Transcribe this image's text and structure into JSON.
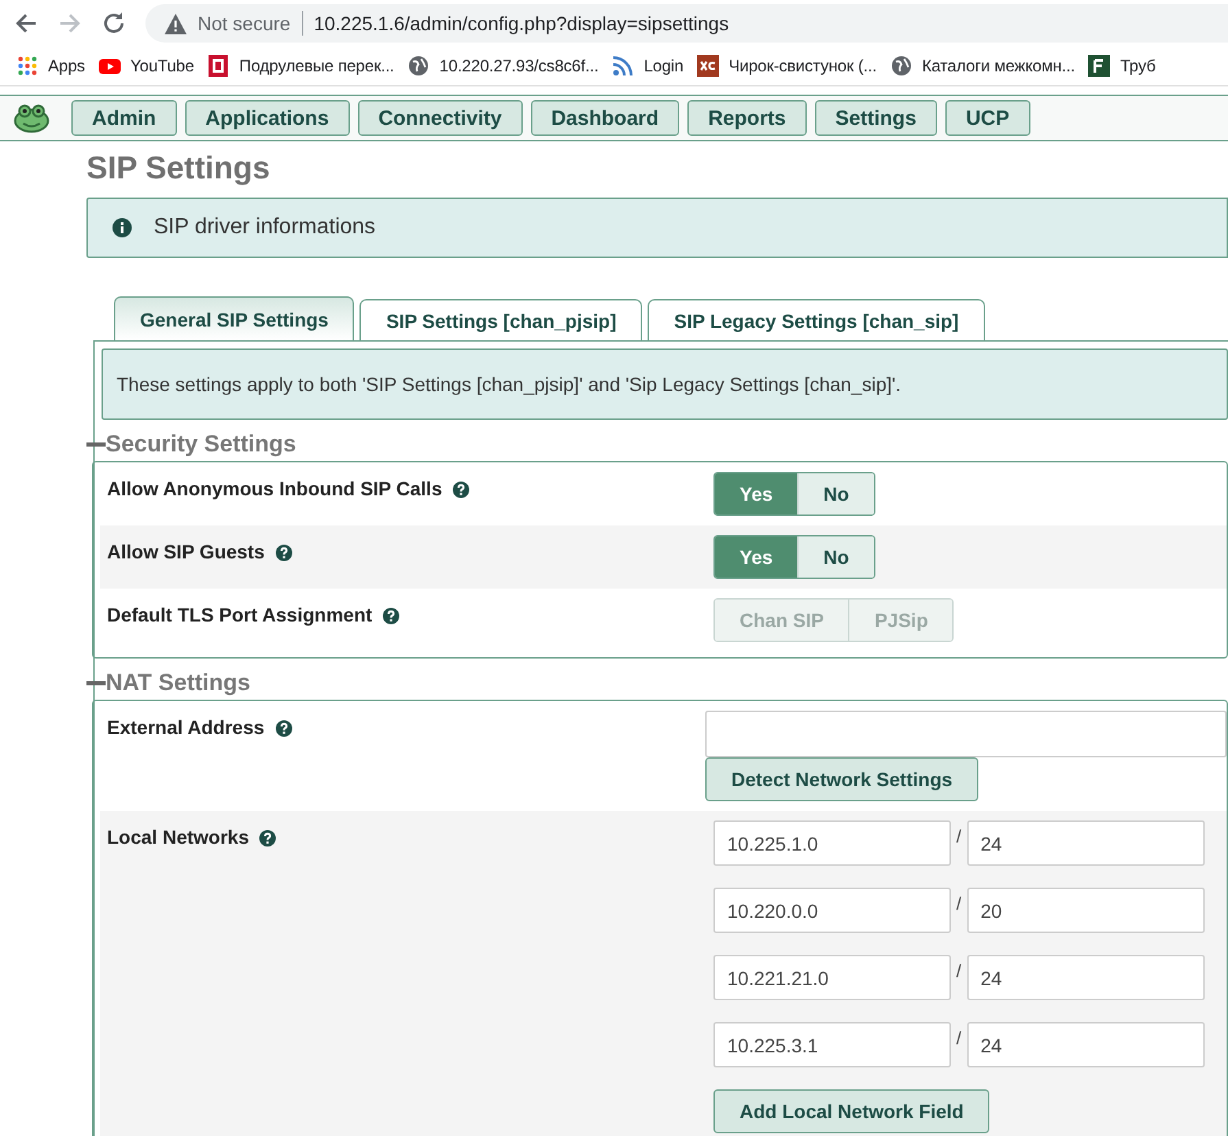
{
  "browser": {
    "security": "Not secure",
    "url": "10.225.1.6/admin/config.php?display=sipsettings"
  },
  "bookmarks": [
    {
      "label": "Apps",
      "kind": "apps"
    },
    {
      "label": "YouTube",
      "kind": "youtube"
    },
    {
      "label": "Подрулевые перек...",
      "kind": "red"
    },
    {
      "label": "10.220.27.93/cs8c6f...",
      "kind": "globe"
    },
    {
      "label": "Login",
      "kind": "rss"
    },
    {
      "label": "Чирок-свистунок (...",
      "kind": "xc"
    },
    {
      "label": "Каталоги межкомн...",
      "kind": "globe"
    },
    {
      "label": "Труб",
      "kind": "green"
    }
  ],
  "nav": [
    "Admin",
    "Applications",
    "Connectivity",
    "Dashboard",
    "Reports",
    "Settings",
    "UCP"
  ],
  "page_title": "SIP Settings",
  "alert": "SIP driver informations",
  "tabs": [
    {
      "label": "General SIP Settings",
      "selected": true
    },
    {
      "label": "SIP Settings [chan_pjsip]",
      "selected": false
    },
    {
      "label": "SIP Legacy Settings [chan_sip]",
      "selected": false
    }
  ],
  "tab_note": "These settings apply to both 'SIP Settings [chan_pjsip]' and 'Sip Legacy Settings [chan_sip]'.",
  "sections": [
    {
      "title": "Security Settings",
      "expanded": true,
      "rows": [
        {
          "label": "Allow Anonymous Inbound SIP Calls",
          "kind": "toggle",
          "disabled": false,
          "options": [
            {
              "label": "Yes",
              "selected": true
            },
            {
              "label": "No",
              "selected": false
            }
          ]
        },
        {
          "label": "Allow SIP Guests",
          "kind": "toggle",
          "disabled": false,
          "options": [
            {
              "label": "Yes",
              "selected": true
            },
            {
              "label": "No",
              "selected": false
            }
          ]
        },
        {
          "label": "Default TLS Port Assignment",
          "kind": "toggle",
          "disabled": true,
          "options": [
            {
              "label": "Chan SIP"
            },
            {
              "label": "PJSip"
            }
          ]
        }
      ]
    },
    {
      "title": "NAT Settings",
      "expanded": true,
      "rows": [
        {
          "label": "External Address",
          "kind": "address",
          "button": "Detect Network Settings"
        },
        {
          "label": "Local Networks",
          "kind": "networks",
          "networks": [
            {
              "address": "10.225.1.0",
              "separator": "/",
              "cidr": "24"
            },
            {
              "address": "10.220.0.0",
              "separator": "/",
              "cidr": "20"
            },
            {
              "address": "10.221.21.0",
              "separator": "/",
              "cidr": "24"
            },
            {
              "address": "10.225.3.1",
              "separator": "/",
              "cidr": "24"
            }
          ],
          "button": "Add Local Network Field"
        }
      ]
    }
  ]
}
